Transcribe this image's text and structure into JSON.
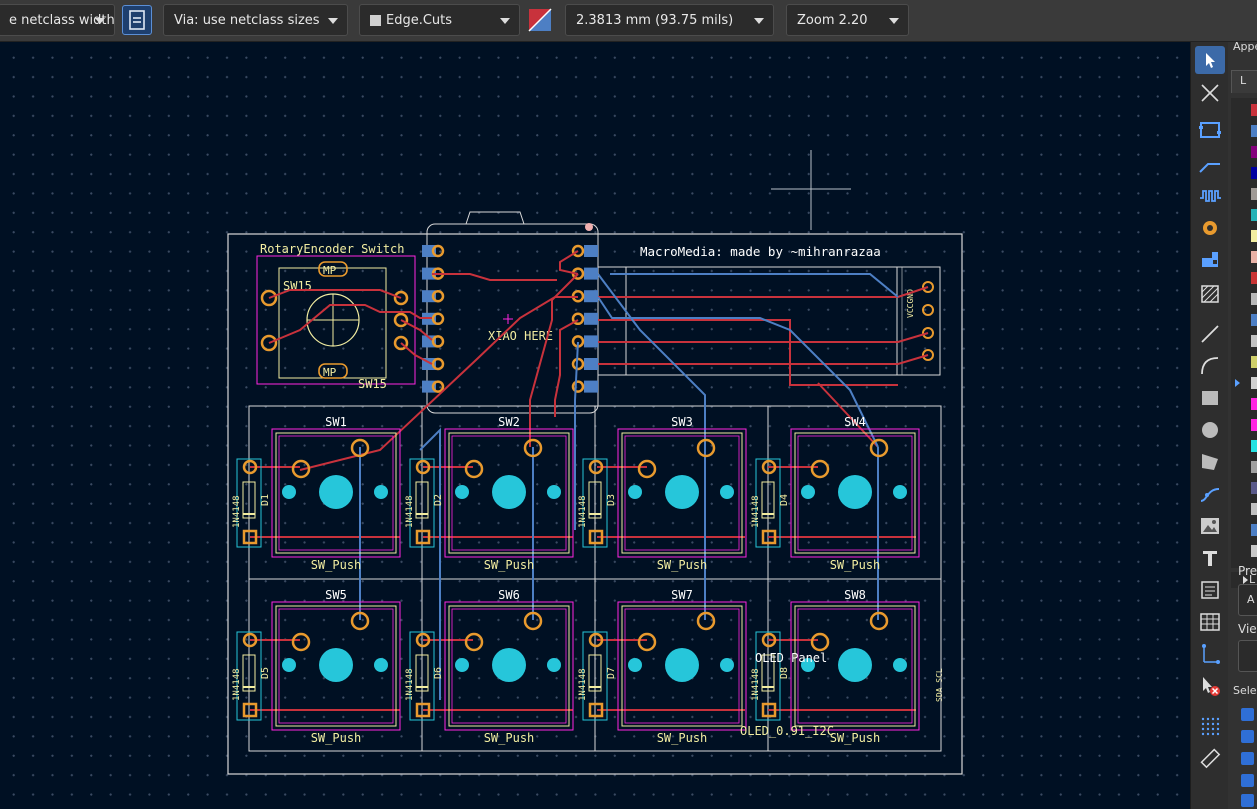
{
  "toolbar": {
    "track_width": "e netclass width",
    "via_size": "Via: use netclass sizes",
    "layer": "Edge.Cuts",
    "grid": "2.3813 mm (93.75 mils)",
    "zoom": "Zoom 2.20"
  },
  "board": {
    "title": "MacroMedia: made by ~mihranrazaa",
    "xiao_label": "XIAO HERE",
    "encoder_ref": "RotaryEncoder_Switch",
    "encoder_value": "SW15",
    "encoder_value_bottom": "SW15",
    "encoder_mp_top": "MP",
    "encoder_mp_bottom": "MP",
    "oled_label": "OLED Panel",
    "oled_value": "OLED_0.91_I2C",
    "oled_pins_top": "VCCGND",
    "oled_pins_side": "SDA SCL",
    "switches": [
      {
        "ref": "SW1",
        "value": "SW_Push",
        "diode": "D1"
      },
      {
        "ref": "SW2",
        "value": "SW_Push",
        "diode": "D2"
      },
      {
        "ref": "SW3",
        "value": "SW_Push",
        "diode": "D3"
      },
      {
        "ref": "SW4",
        "value": "SW_Push",
        "diode": "D4"
      },
      {
        "ref": "SW5",
        "value": "SW_Push",
        "diode": "D5"
      },
      {
        "ref": "SW6",
        "value": "SW_Push",
        "diode": "D6"
      },
      {
        "ref": "SW7",
        "value": "SW_Push",
        "diode": "D7"
      },
      {
        "ref": "SW8",
        "value": "SW_Push",
        "diode": "D8"
      }
    ],
    "diode_value": "1N4148"
  },
  "right_panel": {
    "appearance": "Appe",
    "layers_tab": "L",
    "presets": "Pre",
    "viewports": "View",
    "selection": "Sele",
    "preset_value": "A",
    "layers_expander": "L"
  },
  "colors": {
    "track_front": "#c8323c",
    "track_back": "#4d7fc4",
    "pad": "#e89a2e",
    "courtyard": "#ff26e2",
    "silk": "#f2eda1",
    "accent": "#3c6aa8"
  },
  "icons": [
    "route-icon",
    "via-icon",
    "layer-color-icon",
    "select-icon",
    "measure-icon",
    "text-icon",
    "grid-icon"
  ]
}
